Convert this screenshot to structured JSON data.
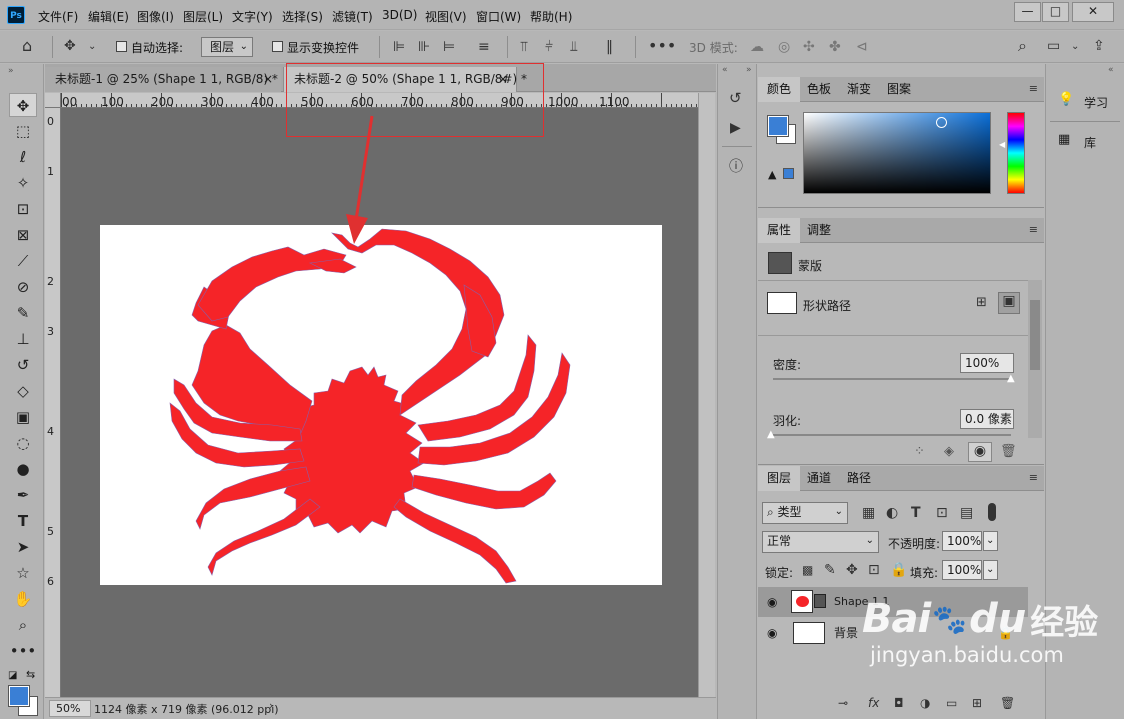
{
  "menu": {
    "logo": "Ps",
    "items": [
      "文件(F)",
      "编辑(E)",
      "图像(I)",
      "图层(L)",
      "文字(Y)",
      "选择(S)",
      "滤镜(T)",
      "3D(D)",
      "视图(V)",
      "窗口(W)",
      "帮助(H)"
    ]
  },
  "options": {
    "auto_select_label": "自动选择:",
    "auto_select_value": "图层",
    "show_transform_label": "显示变换控件",
    "mode_3d_label": "3D 模式:"
  },
  "tabs": [
    {
      "label": "未标题-1 @ 25% (Shape 1 1, RGB/8) *",
      "close": "×"
    },
    {
      "label": "未标题-2 @ 50% (Shape 1 1, RGB/8#) *",
      "close": "×"
    }
  ],
  "ruler": {
    "top": [
      "00",
      "100",
      "200",
      "300",
      "400",
      "500",
      "600",
      "700",
      "800",
      "900",
      "1000",
      "1100"
    ],
    "left": [
      "0",
      "1",
      "2",
      "3",
      "4",
      "5",
      "6"
    ]
  },
  "status": {
    "zoom": "50%",
    "info": "1124 像素 x 719 像素 (96.012 ppi)"
  },
  "color_panel": {
    "tabs": [
      "颜色",
      "色板",
      "渐变",
      "图案"
    ],
    "fg_color": "#3a7fd5",
    "bg_color": "#ffffff"
  },
  "properties_panel": {
    "tabs": [
      "属性",
      "调整"
    ],
    "mask_label": "蒙版",
    "shape_path_label": "形状路径",
    "density_label": "密度:",
    "density_value": "100%",
    "feather_label": "羽化:",
    "feather_value": "0.0 像素"
  },
  "layers_panel": {
    "tabs": [
      "图层",
      "通道",
      "路径"
    ],
    "filter_value": "类型",
    "blend_mode": "正常",
    "opacity_label": "不透明度:",
    "opacity_value": "100%",
    "lock_label": "锁定:",
    "fill_label": "填充:",
    "fill_value": "100%",
    "layers": [
      {
        "name": "Shape 1 1",
        "selected": true
      },
      {
        "name": "背景",
        "selected": false
      }
    ]
  },
  "right_dock": {
    "learn_label": "学习",
    "library_label": "库"
  },
  "watermark": {
    "brand": "Bai",
    "brand2": "du",
    "cn": "经验",
    "url": "jingyan.baidu.com"
  },
  "colors": {
    "crab": "#f52428",
    "callout": "#e03030",
    "canvas_bg": "#6b6b6b"
  }
}
